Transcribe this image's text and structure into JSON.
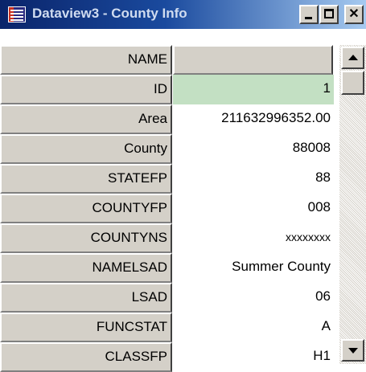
{
  "window": {
    "title": "Dataview3 - County Info",
    "icon": "table-app-icon",
    "buttons": {
      "minimize": "minimize-icon",
      "maximize": "maximize-icon",
      "close": "✕"
    }
  },
  "fields": [
    {
      "name": "NAME",
      "value": ""
    },
    {
      "name": "ID",
      "value": "1"
    },
    {
      "name": "Area",
      "value": "211632996352.00"
    },
    {
      "name": "County",
      "value": "88008"
    },
    {
      "name": "STATEFP",
      "value": "88"
    },
    {
      "name": "COUNTYFP",
      "value": "008"
    },
    {
      "name": "COUNTYNS",
      "value": "xxxxxxxx"
    },
    {
      "name": "NAMELSAD",
      "value": "Summer County"
    },
    {
      "name": "LSAD",
      "value": "06"
    },
    {
      "name": "FUNCSTAT",
      "value": "A"
    },
    {
      "name": "CLASSFP",
      "value": "H1"
    }
  ],
  "selected_value_color": "#c3e0c3",
  "scrollbar": {
    "up_icon": "scroll-up-arrow-icon",
    "down_icon": "scroll-down-arrow-icon"
  }
}
